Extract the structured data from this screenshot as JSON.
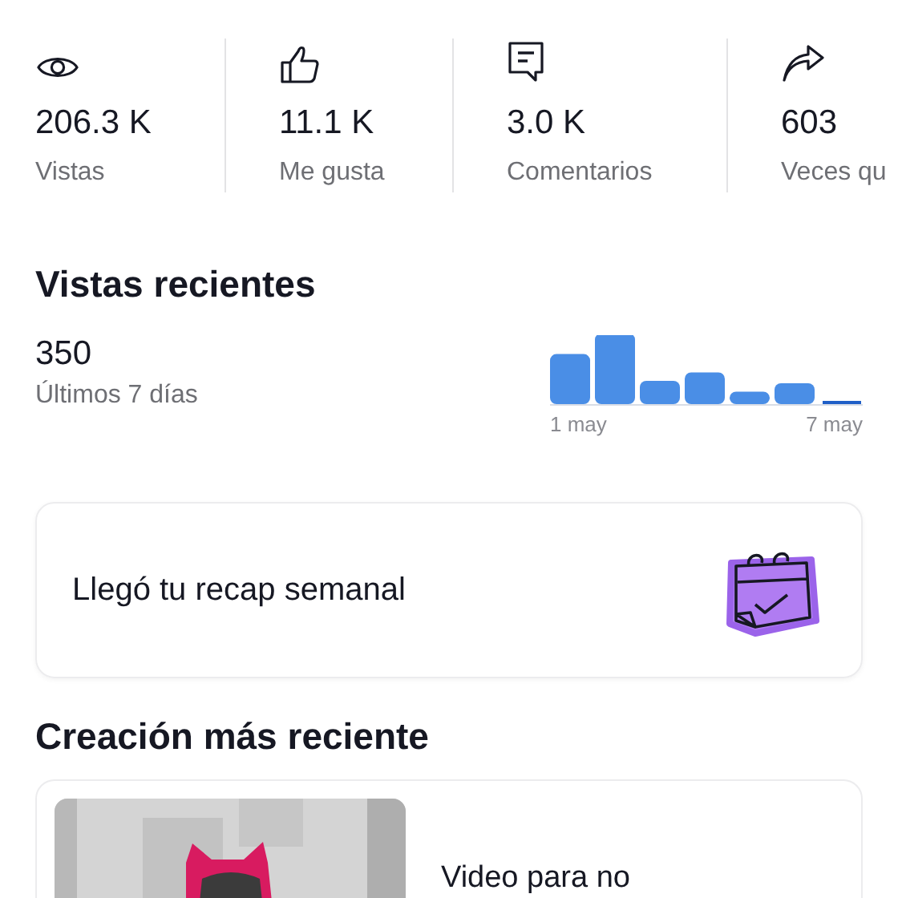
{
  "stats": [
    {
      "kind": "views",
      "value": "206.3 K",
      "label": "Vistas"
    },
    {
      "kind": "likes",
      "value": "11.1 K",
      "label": "Me gusta"
    },
    {
      "kind": "comments",
      "value": "3.0 K",
      "label": "Comentarios"
    },
    {
      "kind": "shares",
      "value": "603",
      "label": "Veces qu"
    }
  ],
  "recent_views": {
    "title": "Vistas recientes",
    "count": "350",
    "period": "Últimos 7 días",
    "axis_start": "1 may",
    "axis_end": "7 may"
  },
  "recap_card": {
    "text": "Llegó tu recap semanal"
  },
  "latest": {
    "title": "Creación más reciente",
    "video": {
      "title": "Video para no"
    }
  }
}
